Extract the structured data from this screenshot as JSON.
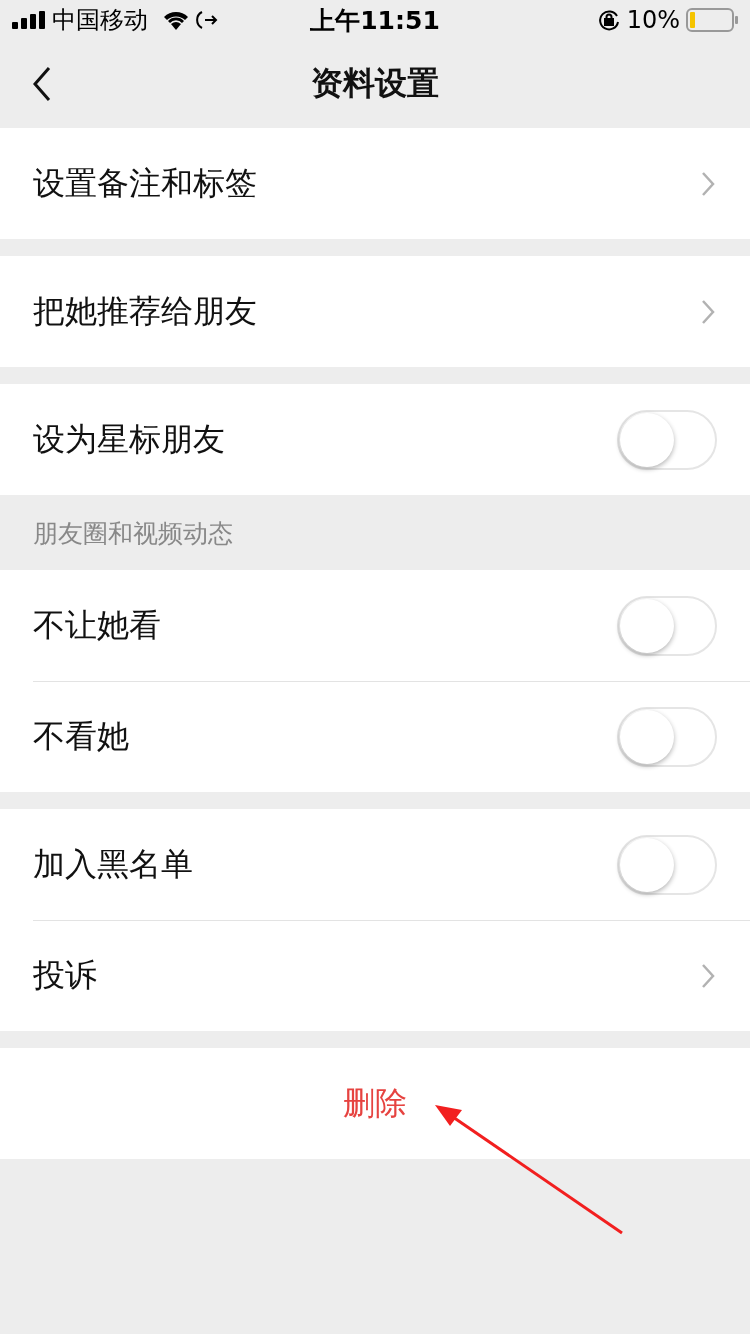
{
  "status_bar": {
    "carrier": "中国移动",
    "time": "上午11:51",
    "battery": "10%"
  },
  "nav": {
    "title": "资料设置"
  },
  "groups": [
    {
      "items": [
        {
          "kind": "link",
          "label": "设置备注和标签"
        }
      ]
    },
    {
      "items": [
        {
          "kind": "link",
          "label": "把她推荐给朋友"
        }
      ]
    },
    {
      "items": [
        {
          "kind": "toggle",
          "label": "设为星标朋友",
          "on": false
        }
      ]
    },
    {
      "header": "朋友圈和视频动态",
      "items": [
        {
          "kind": "toggle",
          "label": "不让她看",
          "on": false
        },
        {
          "kind": "toggle",
          "label": "不看她",
          "on": false
        }
      ]
    },
    {
      "items": [
        {
          "kind": "toggle",
          "label": "加入黑名单",
          "on": false
        },
        {
          "kind": "link",
          "label": "投诉"
        }
      ]
    }
  ],
  "delete_button": "删除"
}
